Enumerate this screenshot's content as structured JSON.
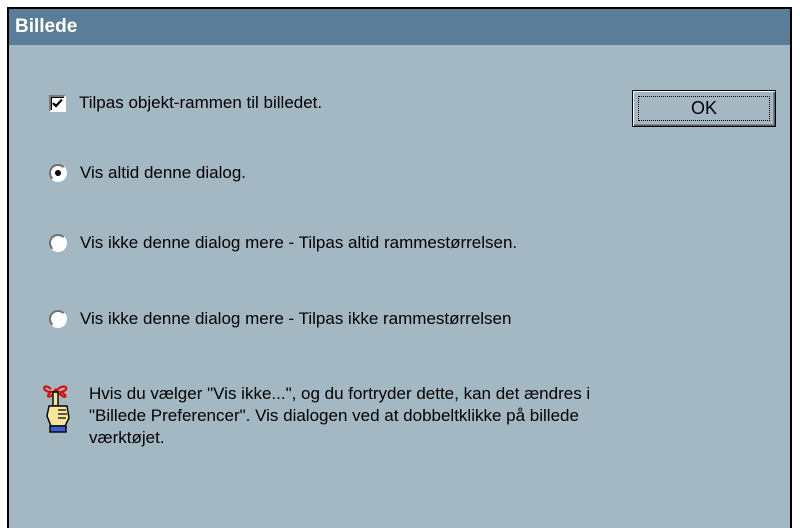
{
  "dialog": {
    "title": "Billede",
    "checkbox": {
      "label": "Tilpas objekt-rammen til billedet.",
      "checked": true
    },
    "ok_label": "OK",
    "options": [
      {
        "label": "Vis altid denne dialog.",
        "selected": true
      },
      {
        "label": "Vis ikke denne dialog mere - Tilpas altid rammestørrelsen.",
        "selected": false
      },
      {
        "label": "Vis ikke denne dialog mere - Tilpas ikke rammestørrelsen",
        "selected": false
      }
    ],
    "note": {
      "icon": "finger-with-ribbon-icon",
      "lines": [
        "Hvis du vælger \"Vis ikke...\", og du fortryder dette, kan det ændres i",
        "\"Billede Preferencer\". Vis dialogen ved at dobbeltklikke på billede",
        "værktøjet."
      ]
    }
  },
  "colors": {
    "dialog_bg": "#a4b8c4",
    "titlebar_bg": "#5b7e98",
    "title_text": "#ffffff"
  }
}
